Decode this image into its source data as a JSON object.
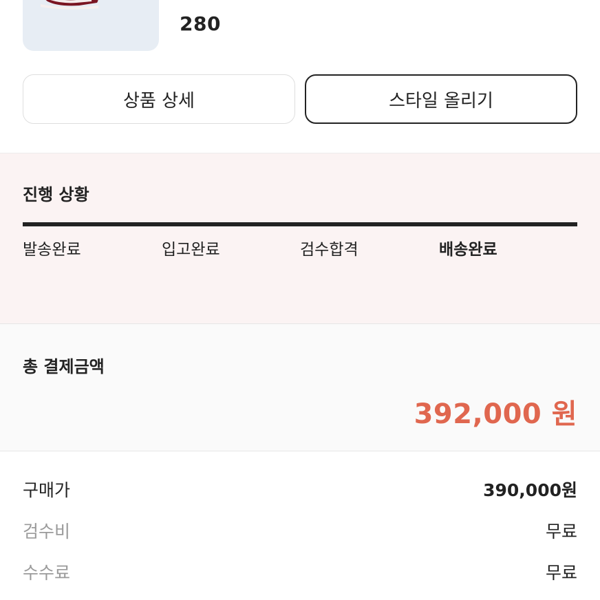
{
  "product": {
    "size": "280",
    "image_icon": "sneaker-icon"
  },
  "actions": {
    "detail_label": "상품 상세",
    "style_label": "스타일 올리기"
  },
  "progress": {
    "title": "진행 상황",
    "steps": [
      "발송완료",
      "입고완료",
      "검수합격",
      "배송완료"
    ],
    "current_step_index": 3,
    "completion": 1.0
  },
  "payment": {
    "title": "총 결제금액",
    "amount": "392,000 원",
    "accent_color": "#e0674f"
  },
  "breakdown": [
    {
      "label": "구매가",
      "value": "390,000원"
    },
    {
      "label": "검수비",
      "value": "무료"
    },
    {
      "label": "수수료",
      "value": "무료"
    }
  ]
}
